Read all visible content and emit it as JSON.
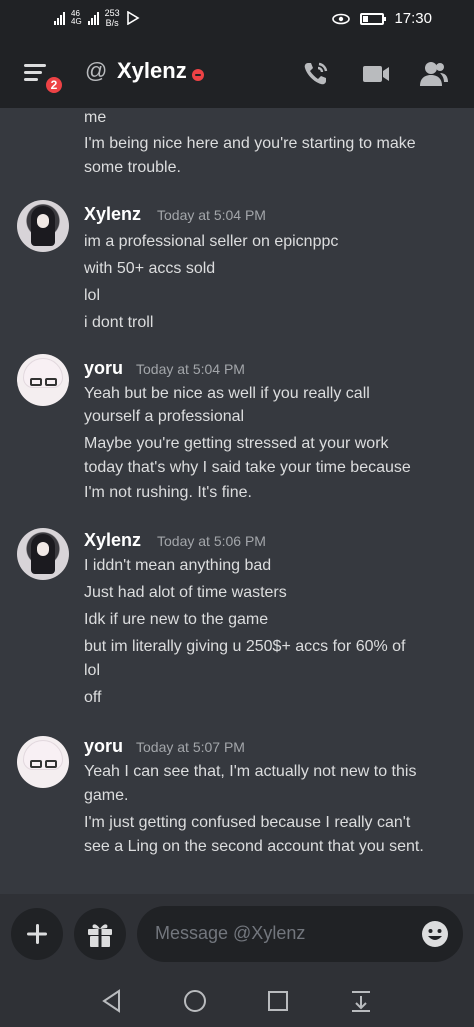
{
  "status_bar": {
    "network": "4G",
    "network_sub": "46",
    "speed_value": "253",
    "speed_unit": "B/s",
    "time": "17:30"
  },
  "header": {
    "notification_count": "2",
    "channel_name": "Xylenz",
    "icons": [
      "menu-icon",
      "at-icon",
      "dnd-status-icon",
      "call-icon",
      "video-icon",
      "members-icon"
    ]
  },
  "continued_lines": [
    "me",
    "I'm being nice here and you're starting to make",
    "some trouble."
  ],
  "messages": [
    {
      "author": "Xylenz",
      "timestamp": "Today at 5:04 PM",
      "lines": [
        "im a professional seller on epicnppc",
        "with 50+ accs sold",
        "lol",
        "i dont troll"
      ]
    },
    {
      "author": "yoru",
      "timestamp": "Today at 5:04 PM",
      "lines": [
        "Yeah but be nice as well if you really call",
        "yourself a professional",
        "Maybe you're getting stressed at your work",
        "today that's why I said take your time because",
        "I'm not rushing. It's fine."
      ]
    },
    {
      "author": "Xylenz",
      "timestamp": "Today at 5:06 PM",
      "lines": [
        "I iddn't mean anything bad",
        "Just had alot of time wasters",
        "Idk if ure new to the game",
        "but im literally giving u 250$+ accs for 60% of",
        "lol",
        "off"
      ]
    },
    {
      "author": "yoru",
      "timestamp": "Today at 5:07 PM",
      "lines": [
        "Yeah I can see that, I'm actually not new to this",
        "game.",
        "I'm just getting confused because I really can't",
        "see a Ling on the second account that you sent."
      ]
    }
  ],
  "composer": {
    "placeholder": "Message @Xylenz"
  },
  "colors": {
    "background": "#36393f",
    "header": "#202225",
    "badge": "#ed4245",
    "text": "#dcddde",
    "timestamp": "#a3a6aa"
  }
}
